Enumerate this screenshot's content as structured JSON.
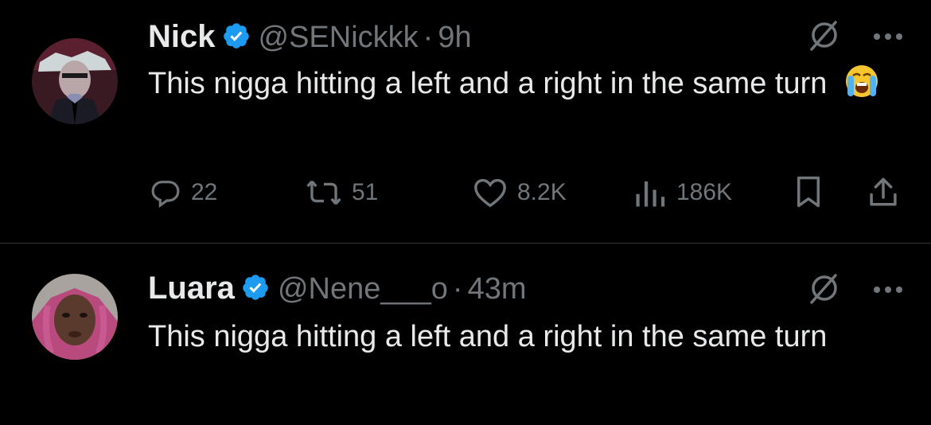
{
  "tweets": [
    {
      "display_name": "Nick",
      "handle": "@SENickkk",
      "separator": "·",
      "time": "9h",
      "text": "This nigga hitting a left and a right in the same turn",
      "emoji": "loudly-crying-face",
      "verified": true,
      "stats": {
        "replies": "22",
        "retweets": "51",
        "likes": "8.2K",
        "views": "186K"
      }
    },
    {
      "display_name": "Luara",
      "handle": "@Nene___o",
      "separator": "·",
      "time": "43m",
      "text": "This nigga hitting a left and a right in the same turn",
      "verified": true
    }
  ],
  "colors": {
    "background": "#000000",
    "text": "#e7e9ea",
    "muted": "#71767b",
    "verified": "#1d9bf0",
    "divider": "#2f3336"
  },
  "icons": [
    "verified-badge-icon",
    "grok-icon",
    "more-icon",
    "reply-icon",
    "retweet-icon",
    "like-icon",
    "views-icon",
    "bookmark-icon",
    "share-icon"
  ]
}
